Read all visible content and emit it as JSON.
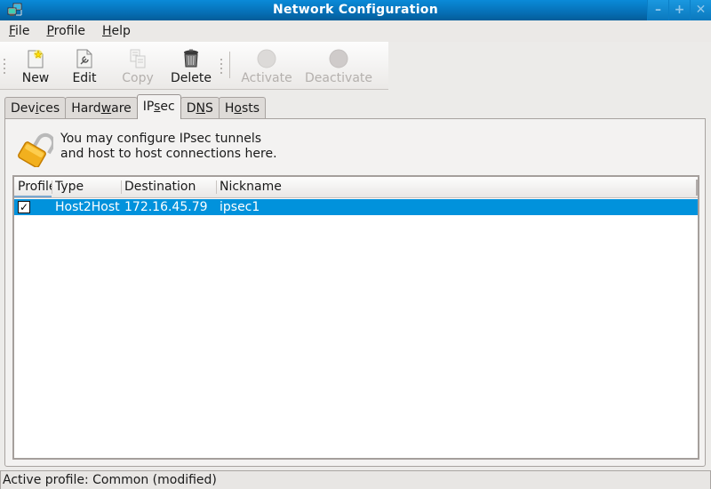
{
  "window": {
    "title": "Network Configuration",
    "controls": {
      "minimize": "–",
      "maximize": "+",
      "close": "✕"
    }
  },
  "menubar": {
    "items": [
      {
        "label": "File",
        "mnemonic": "F",
        "rest": "ile"
      },
      {
        "label": "Profile",
        "mnemonic": "P",
        "rest": "rofile"
      },
      {
        "label": "Help",
        "mnemonic": "H",
        "rest": "elp"
      }
    ]
  },
  "toolbar": {
    "buttons": [
      {
        "label": "New",
        "icon": "new-document-star-icon",
        "enabled": true
      },
      {
        "label": "Edit",
        "icon": "edit-document-wrench-icon",
        "enabled": true
      },
      {
        "label": "Copy",
        "icon": "copy-icon",
        "enabled": false
      },
      {
        "label": "Delete",
        "icon": "trash-icon",
        "enabled": true
      },
      {
        "label": "Activate",
        "icon": "activate-circle-icon",
        "enabled": false
      },
      {
        "label": "Deactivate",
        "icon": "deactivate-circle-icon",
        "enabled": false
      }
    ]
  },
  "tabs": [
    {
      "label": "Devices",
      "pre": "Dev",
      "mnemonic": "i",
      "post": "ces",
      "active": false
    },
    {
      "label": "Hardware",
      "pre": "Hard",
      "mnemonic": "w",
      "post": "are",
      "active": false
    },
    {
      "label": "IPsec",
      "pre": "IP",
      "mnemonic": "s",
      "post": "ec",
      "active": true
    },
    {
      "label": "DNS",
      "pre": "D",
      "mnemonic": "N",
      "post": "S",
      "active": false
    },
    {
      "label": "Hosts",
      "pre": "H",
      "mnemonic": "o",
      "post": "sts",
      "active": false
    }
  ],
  "ipsec": {
    "intro_line1": "You may configure IPsec tunnels",
    "intro_line2": "and host to host connections here.",
    "table": {
      "columns": [
        "Profile",
        "Type",
        "Destination",
        "Nickname"
      ],
      "rows": [
        {
          "profile_checked": true,
          "type": "Host2Host",
          "destination": "172.16.45.79",
          "nickname": "ipsec1",
          "selected": true
        }
      ]
    }
  },
  "statusbar": {
    "text": "Active profile: Common (modified)"
  },
  "colors": {
    "titlebar": "#0670b6",
    "selection": "#0192dc"
  }
}
